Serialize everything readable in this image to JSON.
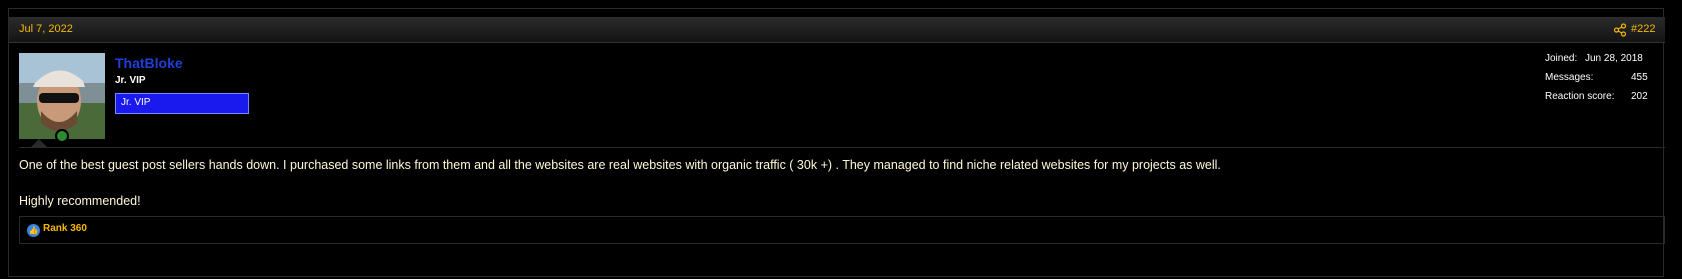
{
  "post": {
    "date": "Jul 7, 2022",
    "number": "#222",
    "share_icon": "share-icon"
  },
  "author": {
    "username": "ThatBloke",
    "title": "Jr. VIP",
    "banner": "Jr. VIP",
    "online_icon": "user-online-icon",
    "stats": [
      {
        "label": "Joined:",
        "value": "Jun 28, 2018"
      },
      {
        "label": "Messages:",
        "value": "455"
      },
      {
        "label": "Reaction score:",
        "value": "202"
      }
    ]
  },
  "message": {
    "paragraph1": "One of the best guest post sellers hands down. I purchased some links from them and all the websites are real websites with organic traffic ( 30k +) . They managed to find niche related websites for my projects as well.",
    "paragraph2": "Highly recommended!"
  },
  "reactions": {
    "icon": "like-icon",
    "text": "Rank 360"
  },
  "colors": {
    "accent": "#f5b800",
    "username": "#1e3fd9",
    "banner_bg": "#1a1aee",
    "text": "#fff8d8",
    "like": "#3a82e0"
  }
}
